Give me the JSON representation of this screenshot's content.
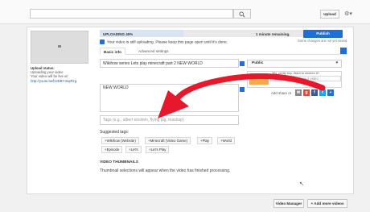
{
  "topbar": {
    "search_placeholder": "",
    "upload_label": "Upload",
    "settings_icon": "gear-icon"
  },
  "left_panel": {
    "status_heading": "Upload status:",
    "status_text": "Uploading your video",
    "url_label": "Your video will be live at:",
    "url": "http://youtu.be/bSDBY4sqRzg"
  },
  "upload": {
    "progress_label": "UPLOADING 40%",
    "progress_fraction": 0.4,
    "time_remaining": "1 minute remaining.",
    "publish_label": "Publish",
    "unsaved_note": "Some changes are not yet saved.",
    "notice": "Your video is still uploading. Please keep this page open until it's done."
  },
  "tabs": [
    {
      "label": "Basic info"
    },
    {
      "label": "Advanced settings"
    }
  ],
  "form": {
    "title_value": "Wikihow series Lets play minecraft part  2 NEW WORLD",
    "description_value": "NEW WORLD",
    "tags_placeholder": "Tags (e.g., albert einstein, flying pig, mashup)",
    "privacy_value": "Public",
    "share_promo": "Yes, pretty boy. Ward to shorten it?",
    "share_placeholder": "Add a message to your video",
    "add_share_label": "Add share ot"
  },
  "suggested": {
    "label": "Suggested tags:",
    "chips": [
      "+Wikihow (Website)",
      "+Minecraft (Video Game)",
      "+Play",
      "+World",
      "+Episode",
      "+Let's",
      "+Let's Play"
    ]
  },
  "thumbnails": {
    "title": "VIDEO THUMBNAILS",
    "message": "Thumbnail selections will appear when the video has finished processing."
  },
  "footer": {
    "video_manager_label": "Video Manager",
    "add_more_label": "+ Add more videos"
  },
  "colors": {
    "accent": "#1f6fd6",
    "arrow": "#e8182c"
  }
}
